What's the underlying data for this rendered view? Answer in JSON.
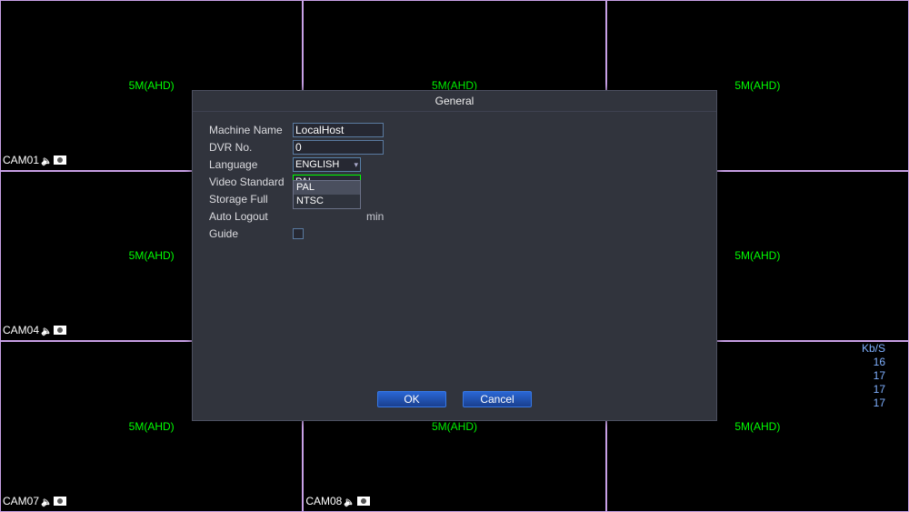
{
  "grid": {
    "resolution_label": "5M(AHD)",
    "cells": [
      {
        "cam": "CAM01"
      },
      {
        "cam": ""
      },
      {
        "cam": ""
      },
      {
        "cam": "CAM04"
      },
      {
        "cam": ""
      },
      {
        "cam": ""
      },
      {
        "cam": "CAM07"
      },
      {
        "cam": "CAM08"
      },
      {
        "cam": ""
      }
    ]
  },
  "dialog": {
    "title": "General",
    "labels": {
      "machine_name": "Machine Name",
      "dvr_no": "DVR No.",
      "language": "Language",
      "video_standard": "Video Standard",
      "storage_full": "Storage Full",
      "auto_logout": "Auto Logout",
      "guide": "Guide"
    },
    "values": {
      "machine_name": "LocalHost",
      "dvr_no": "0",
      "language": "ENGLISH",
      "video_standard": "PAL",
      "auto_logout_unit": "min"
    },
    "video_standard_options": [
      "PAL",
      "NTSC"
    ],
    "buttons": {
      "ok": "OK",
      "cancel": "Cancel"
    }
  },
  "stats": {
    "header": "Kb/S",
    "rows": [
      "16",
      "17",
      "17",
      "17"
    ]
  }
}
